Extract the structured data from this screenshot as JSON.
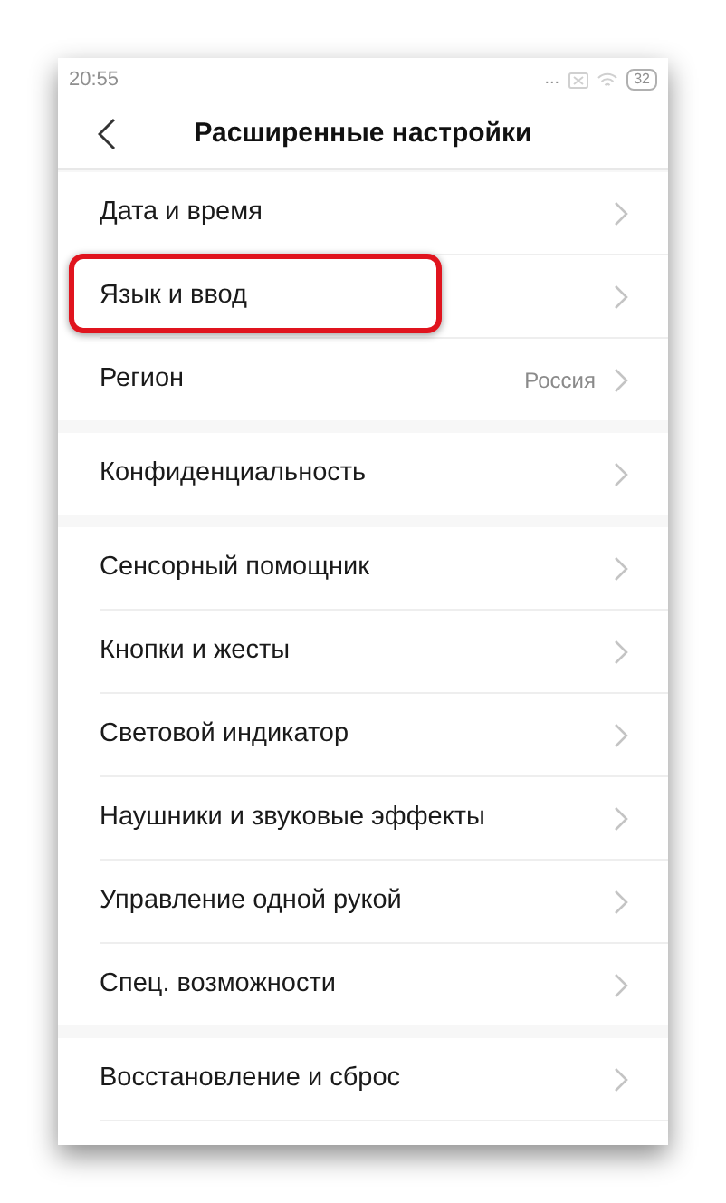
{
  "status_bar": {
    "time": "20:55",
    "dots": "...",
    "battery": "32"
  },
  "header": {
    "title": "Расширенные настройки"
  },
  "sections": [
    {
      "items": [
        {
          "label": "Дата и время",
          "highlighted": false
        },
        {
          "label": "Язык и ввод",
          "highlighted": true
        },
        {
          "label": "Регион",
          "value": "Россия",
          "highlighted": false
        }
      ]
    },
    {
      "items": [
        {
          "label": "Конфиденциальность",
          "highlighted": false
        }
      ]
    },
    {
      "items": [
        {
          "label": "Сенсорный помощник",
          "highlighted": false
        },
        {
          "label": "Кнопки и жесты",
          "highlighted": false
        },
        {
          "label": "Световой индикатор",
          "highlighted": false
        },
        {
          "label": "Наушники и звуковые эффекты",
          "highlighted": false
        },
        {
          "label": "Управление одной рукой",
          "highlighted": false
        },
        {
          "label": "Спец. возможности",
          "highlighted": false
        }
      ]
    },
    {
      "items": [
        {
          "label": "Восстановление и сброс",
          "highlighted": false
        }
      ]
    }
  ]
}
